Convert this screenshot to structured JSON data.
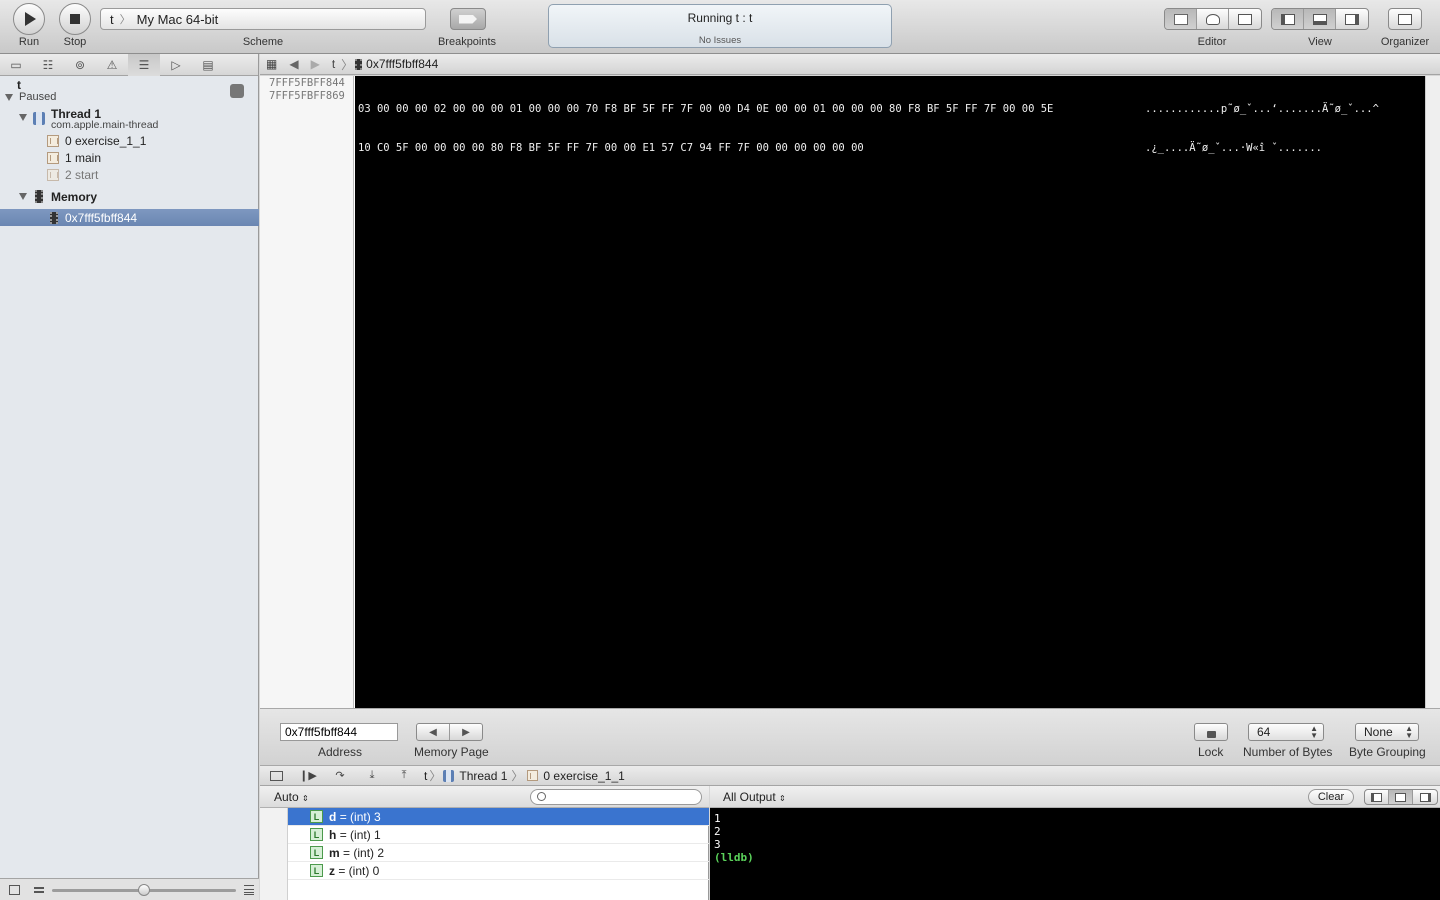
{
  "toolbar": {
    "run_label": "Run",
    "stop_label": "Stop",
    "scheme_target": "t",
    "scheme_destination": "My Mac 64-bit",
    "scheme_label": "Scheme",
    "breakpoints_label": "Breakpoints",
    "activity_status": "Running t : t",
    "activity_issues": "No Issues",
    "editor_label": "Editor",
    "view_label": "View",
    "organizer_label": "Organizer"
  },
  "navigator": {
    "process_name": "t",
    "process_status": "Paused",
    "thread_name": "Thread 1",
    "thread_queue": "com.apple.main-thread",
    "frames": [
      {
        "label": "0 exercise_1_1"
      },
      {
        "label": "1 main"
      },
      {
        "label": "2 start"
      }
    ],
    "memory_group": "Memory",
    "memory_item": "0x7fff5fbff844"
  },
  "jumpbar": {
    "project": "t",
    "item": "0x7fff5fbff844"
  },
  "memory": {
    "rows": [
      {
        "address": "7FFF5FBFF844",
        "hex": "03 00 00 00 02 00 00 00 01 00 00 00 70 F8 BF 5F FF 7F 00 00 D4 0E 00 00 01 00 00 00 80 F8 BF 5F FF 7F 00 00 5E",
        "ascii": "............p˜ø_ˇ...‘.......Ä˜ø_ˇ...^"
      },
      {
        "address": "7FFF5FBFF869",
        "hex": "10 C0 5F 00 00 00 00 80 F8 BF 5F FF 7F 00 00 E1 57 C7 94 FF 7F 00 00 00 00 00 00",
        "ascii": ".¿_....Ä˜ø_ˇ...·W«î ˇ......."
      }
    ]
  },
  "memory_controls": {
    "address_value": "0x7fff5fbff844",
    "address_label": "Address",
    "page_label": "Memory Page",
    "lock_label": "Lock",
    "bytes_value": "64",
    "bytes_label": "Number of Bytes",
    "grouping_value": "None",
    "grouping_label": "Byte Grouping"
  },
  "debugbar": {
    "project": "t",
    "thread": "Thread 1",
    "frame": "0 exercise_1_1"
  },
  "variables": {
    "scope": "Auto",
    "items": [
      {
        "name": "d",
        "value": "= (int) 3"
      },
      {
        "name": "h",
        "value": "= (int) 1"
      },
      {
        "name": "m",
        "value": "= (int) 2"
      },
      {
        "name": "z",
        "value": "= (int) 0"
      }
    ]
  },
  "console": {
    "filter": "All Output",
    "clear_label": "Clear",
    "lines": [
      "1",
      "2",
      "3"
    ],
    "prompt": "(lldb)"
  },
  "colors": {
    "selection": "#3a74cf",
    "lldb_prompt": "#5bd35b",
    "memory_bg": "#000000"
  }
}
